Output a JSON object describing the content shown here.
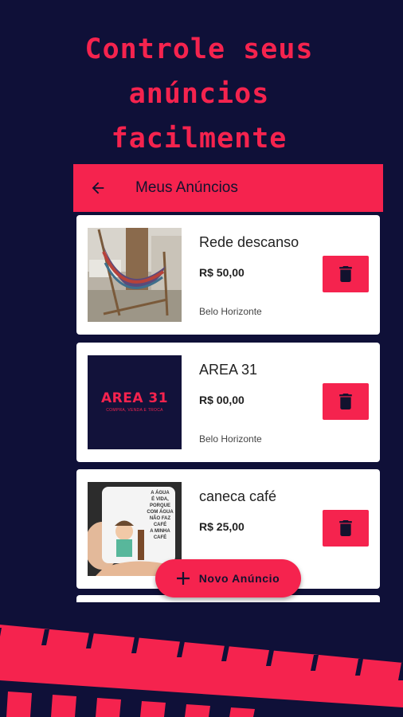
{
  "headline": {
    "line1": "Controle seus",
    "line2": "anúncios",
    "line3": "facilmente"
  },
  "appbar": {
    "back_icon": "arrow-back-icon",
    "title": "Meus Anúncios"
  },
  "listings": [
    {
      "title": "Rede descanso",
      "price": "R$ 50,00",
      "city": "Belo Horizonte"
    },
    {
      "title": "AREA 31",
      "price": "R$ 00,00",
      "city": "Belo Horizonte",
      "logo_text": "AREA 31",
      "logo_sub": "COMPRA, VENDA E TROCA"
    },
    {
      "title": "caneca café",
      "price": "R$ 25,00",
      "mug_text": [
        "A ÁGUA",
        "É VIDA,",
        "PORQUE",
        "COM ÁGUA",
        "NÃO FAZ",
        "CAFÉ",
        "A MINHA",
        "CAFÉ"
      ]
    }
  ],
  "fab": {
    "icon": "plus-icon",
    "label": "Novo Anúncio"
  },
  "colors": {
    "background": "#0f1038",
    "accent": "#f5234e",
    "card": "#ffffff"
  }
}
